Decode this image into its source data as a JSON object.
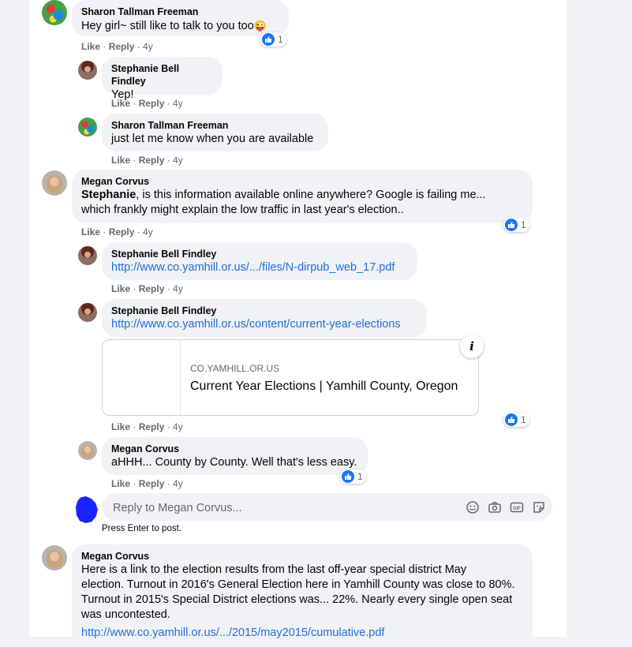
{
  "comments": [
    {
      "name": "Sharon Tallman Freeman",
      "text": "Hey girl~ still like to talk to you too",
      "emoji": "😜",
      "reactions": "1",
      "like": "Like",
      "reply": "Reply",
      "time": "4y"
    },
    {
      "name": "Stephanie Bell Findley",
      "text": "Yep!",
      "like": "Like",
      "reply": "Reply",
      "time": "4y"
    },
    {
      "name": "Sharon Tallman Freeman",
      "text": "just let me know when you are available",
      "like": "Like",
      "reply": "Reply",
      "time": "4y"
    },
    {
      "name": "Megan Corvus",
      "mention": "Stephanie",
      "text_line1": ", is this information available online anywhere? Google is failing me...",
      "text_line2": "which frankly might explain the low traffic in last year's election..",
      "reactions": "1",
      "like": "Like",
      "reply": "Reply",
      "time": "4y"
    },
    {
      "name": "Stephanie Bell Findley",
      "link": "http://www.co.yamhill.or.us/.../files/N-dirpub_web_17.pdf",
      "like": "Like",
      "reply": "Reply",
      "time": "4y"
    },
    {
      "name": "Stephanie Bell Findley",
      "link": "http://www.co.yamhill.or.us/content/current-year-elections",
      "preview_domain": "CO.YAMHILL.OR.US",
      "preview_title": "Current Year Elections | Yamhill County, Oregon",
      "info_glyph": "i",
      "reactions": "1",
      "like": "Like",
      "reply": "Reply",
      "time": "4y"
    },
    {
      "name": "Megan Corvus",
      "text": "aHHH... County by County. Well that's less easy.",
      "reactions": "1",
      "like": "Like",
      "reply": "Reply",
      "time": "4y"
    }
  ],
  "reply_box": {
    "placeholder": "Reply to Megan Corvus...",
    "hint": "Press Enter to post.",
    "gif_label": "GIF"
  },
  "last_comment": {
    "name": "Megan Corvus",
    "lines": [
      "Here is a link to the election results from the last off-year special district May",
      "election. Turnout in 2016's General Election here in Yamhill County was close to 80%.",
      "Turnout in 2015's Special District elections was... 22%. Nearly every single open seat",
      "was uncontested."
    ],
    "link": "http://www.co.yamhill.or.us/.../2015/may2015/cumulative.pdf"
  },
  "icons": {
    "like": "like-thumb-icon",
    "info": "info-icon",
    "emoji": "emoji-icon",
    "camera": "camera-icon",
    "gif": "gif-icon",
    "sticker": "sticker-icon"
  },
  "colors": {
    "link": "#216fdb",
    "like_blue": "#1877f2",
    "bubble": "#f0f2f5",
    "meta": "#65676b"
  }
}
